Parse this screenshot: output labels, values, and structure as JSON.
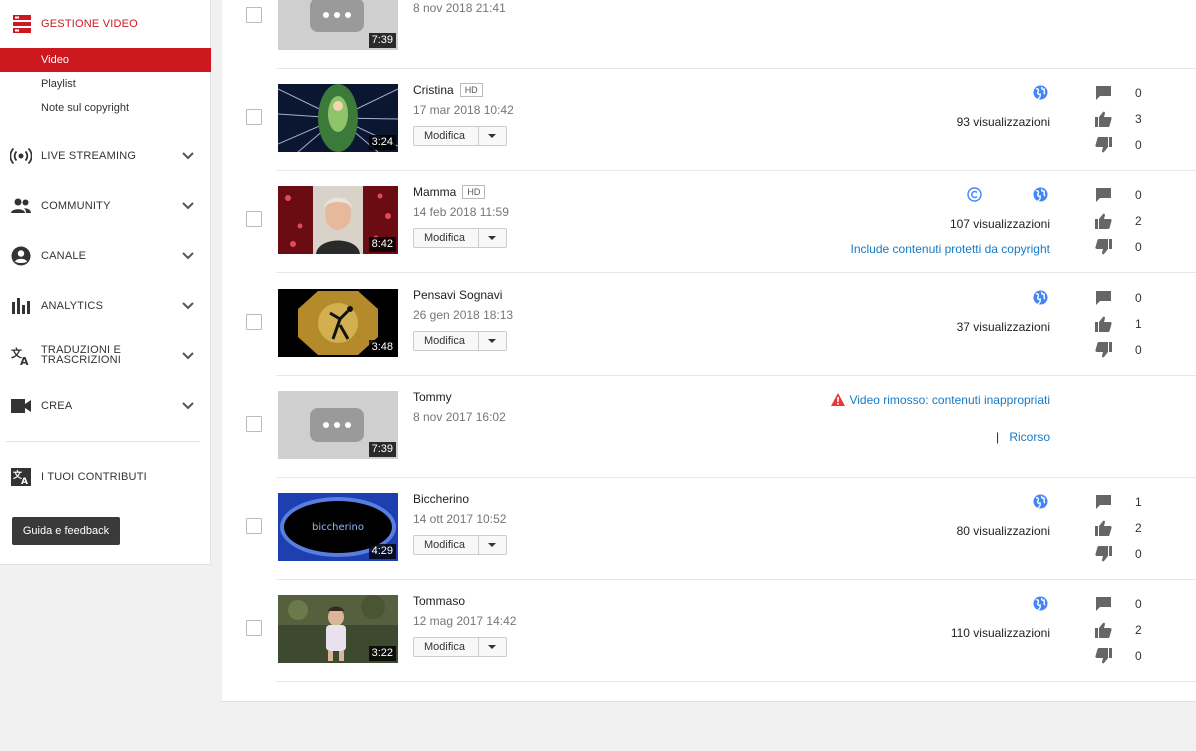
{
  "sidebar": {
    "header": {
      "label": "GESTIONE VIDEO",
      "icon": "video-manager-icon",
      "color": "#cc181e"
    },
    "subitems": [
      {
        "label": "Video",
        "active": true
      },
      {
        "label": "Playlist",
        "active": false
      },
      {
        "label": "Note sul copyright",
        "active": false
      }
    ],
    "sections": [
      {
        "label": "LIVE STREAMING",
        "icon": "live-streaming-icon"
      },
      {
        "label": "COMMUNITY",
        "icon": "community-icon"
      },
      {
        "label": "CANALE",
        "icon": "channel-icon"
      },
      {
        "label": "ANALYTICS",
        "icon": "analytics-icon"
      },
      {
        "label": "TRADUZIONI E\nTRASCRIZIONI",
        "line1": "TRADUZIONI E",
        "line2": "TRASCRIZIONI",
        "icon": "translate-icon"
      },
      {
        "label": "CREA",
        "icon": "create-icon"
      }
    ],
    "contributions": {
      "label": "I TUOI CONTRIBUTI",
      "icon": "contributions-icon"
    },
    "help_button": "Guida e feedback"
  },
  "videos": [
    {
      "title": "",
      "date": "8 nov 2018 21:41",
      "duration": "7:39",
      "thumb": "placeholder"
    },
    {
      "title": "Cristina",
      "hd": "HD",
      "date": "17 mar 2018 10:42",
      "duration": "3:24",
      "edit": "Modifica",
      "views": "93 visualizzazioni",
      "comments": "0",
      "likes": "3",
      "dislikes": "0",
      "thumb": "fairy"
    },
    {
      "title": "Mamma",
      "hd": "HD",
      "date": "14 feb 2018 11:59",
      "duration": "8:42",
      "edit": "Modifica",
      "views": "107 visualizzazioni",
      "copyright_note": "Include contenuti protetti da copyright",
      "comments": "0",
      "likes": "2",
      "dislikes": "0",
      "thumb": "portrait"
    },
    {
      "title": "Pensavi Sognavi",
      "date": "26 gen 2018 18:13",
      "duration": "3:48",
      "edit": "Modifica",
      "views": "37 visualizzazioni",
      "comments": "0",
      "likes": "1",
      "dislikes": "0",
      "thumb": "silhouette"
    },
    {
      "title": "Tommy",
      "date": "8 nov 2017 16:02",
      "duration": "7:39",
      "removed_note": "Video rimosso: contenuti inappropriati",
      "appeal_sep": "|",
      "appeal": "Ricorso",
      "thumb": "placeholder"
    },
    {
      "title": "Biccherino",
      "date": "14 ott 2017 10:52",
      "duration": "4:29",
      "edit": "Modifica",
      "views": "80 visualizzazioni",
      "comments": "1",
      "likes": "2",
      "dislikes": "0",
      "thumb": "biccherino",
      "thumb_text": "biccherino"
    },
    {
      "title": "Tommaso",
      "date": "12 mag 2017 14:42",
      "duration": "3:22",
      "edit": "Modifica",
      "views": "110 visualizzazioni",
      "comments": "0",
      "likes": "2",
      "dislikes": "0",
      "thumb": "child"
    }
  ],
  "colors": {
    "accent": "#cc181e",
    "link": "#167ac6",
    "globe": "#4285f4",
    "warning": "#e53935"
  }
}
